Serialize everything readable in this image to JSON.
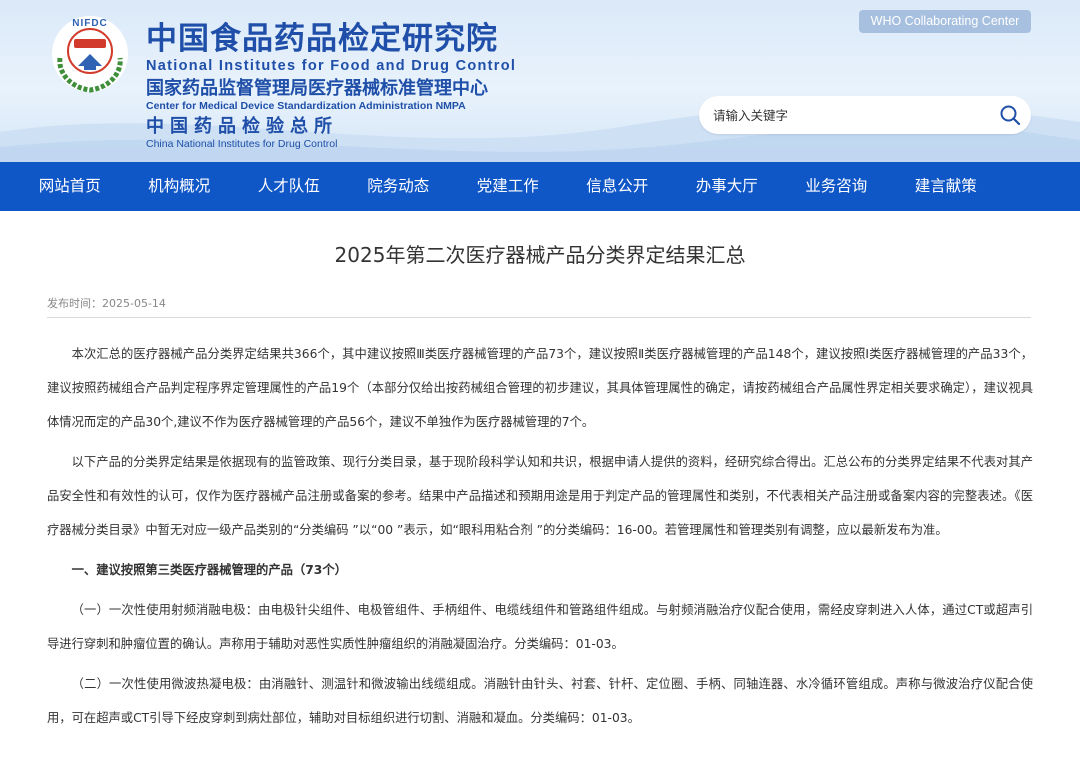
{
  "header": {
    "logo_text_top": "NIFDC",
    "logo_text_center": "中国药检",
    "title_cn": "中国食品药品检定研究院",
    "title_en": "National Institutes for Food and Drug Control",
    "subtitle_cn": "国家药品监督管理局医疗器械标准管理中心",
    "subtitle_en": "Center for Medical Device Standardization Administration NMPA",
    "third_cn": "中国药品检验总所",
    "third_en": "China National Institutes for Drug Control",
    "who_label": "WHO Collaborating Center",
    "search_placeholder": "请输入关键字"
  },
  "nav": {
    "items": [
      {
        "label": "网站首页"
      },
      {
        "label": "机构概况"
      },
      {
        "label": "人才队伍"
      },
      {
        "label": "院务动态"
      },
      {
        "label": "党建工作"
      },
      {
        "label": "信息公开"
      },
      {
        "label": "办事大厅"
      },
      {
        "label": "业务咨询"
      },
      {
        "label": "建言献策"
      }
    ]
  },
  "article": {
    "title": "2025年第二次医疗器械产品分类界定结果汇总",
    "meta": "发布时间：2025-05-14",
    "para1": "本次汇总的医疗器械产品分类界定结果共366个，其中建议按照Ⅲ类医疗器械管理的产品73个，建议按照Ⅱ类医疗器械管理的产品148个，建议按照I类医疗器械管理的产品33个，建议按照药械组合产品判定程序界定管理属性的产品19个（本部分仅给出按药械组合管理的初步建议，其具体管理属性的确定，请按药械组合产品属性界定相关要求确定），建议视具体情况而定的产品30个,建议不作为医疗器械管理的产品56个，建议不单独作为医疗器械管理的7个。",
    "para2": "以下产品的分类界定结果是依据现有的监管政策、现行分类目录，基于现阶段科学认知和共识，根据申请人提供的资料，经研究综合得出。汇总公布的分类界定结果不代表对其产品安全性和有效性的认可，仅作为医疗器械产品注册或备案的参考。结果中产品描述和预期用途是用于判定产品的管理属性和类别，不代表相关产品注册或备案内容的完整表述。《医疗器械分类目录》中暂无对应一级产品类别的“分类编码 ”以“00 ”表示，如“眼科用粘合剂 ”的分类编码：16-00。若管理属性和管理类别有调整，应以最新发布为准。",
    "section1": "一、建议按照第三类医疗器械管理的产品（73个）",
    "item1": "（一）一次性使用射频消融电极：由电极针尖组件、电极管组件、手柄组件、电缆线组件和管路组件组成。与射频消融治疗仪配合使用，需经皮穿刺进入人体，通过CT或超声引导进行穿刺和肿瘤位置的确认。声称用于辅助对恶性实质性肿瘤组织的消融凝固治疗。分类编码：01-03。",
    "item2": "（二）一次性使用微波热凝电极：由消融针、测温针和微波输出线缆组成。消融针由针头、衬套、针杆、定位圈、手柄、同轴连器、水冷循环管组成。声称与微波治疗仪配合使用，可在超声或CT引导下经皮穿刺到病灶部位，辅助对目标组织进行切割、消融和凝血。分类编码：01-03。"
  }
}
